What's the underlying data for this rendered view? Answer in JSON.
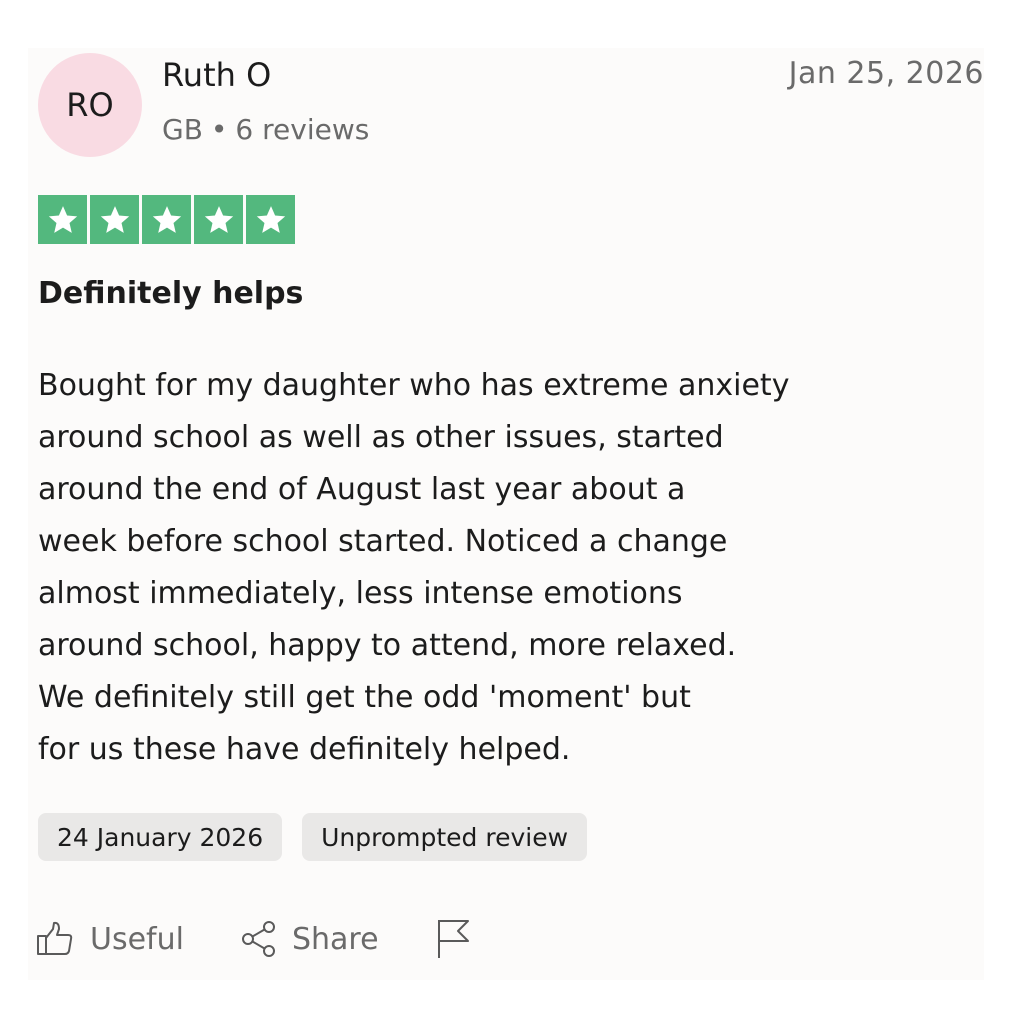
{
  "reviewer": {
    "initials": "RO",
    "name": "Ruth O",
    "country": "GB",
    "separator": "•",
    "review_count": "6 reviews"
  },
  "review": {
    "date": "Jan 25, 2026",
    "rating": 5,
    "max_rating": 5,
    "title": "Definitely helps",
    "body_lines": [
      "Bought for my daughter who has extreme anxiety",
      "around school as well as other issues, started",
      "around the end of August last year about a",
      "week before school started. Noticed a change",
      "almost immediately, less intense emotions",
      "around school, happy to attend, more relaxed.",
      "We definitely still get the odd 'moment' but",
      "for us these have definitely helped."
    ],
    "tags": [
      "24 January 2026",
      "Unprompted review"
    ]
  },
  "actions": {
    "useful_label": "Useful",
    "share_label": "Share",
    "useful_icon": "thumbs-up-icon",
    "share_icon": "share-icon",
    "report_icon": "flag-icon"
  },
  "colors": {
    "star_green": "#53b87e",
    "avatar_bg": "#f9dbe3",
    "tag_bg": "#e9e8e7",
    "muted_text": "#6a6a6a"
  }
}
